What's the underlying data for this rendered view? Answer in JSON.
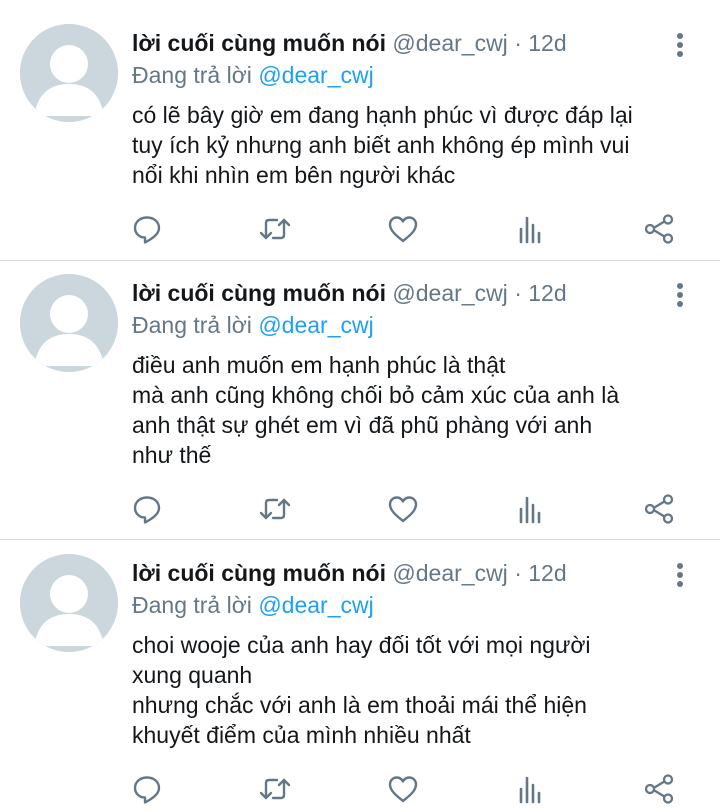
{
  "tweets": [
    {
      "author_name": "lời cuối cùng muốn nói",
      "handle": "@dear_cwj",
      "separator": "·",
      "time": "12d",
      "reply_prefix": "Đang trả lời",
      "reply_handle": "@dear_cwj",
      "lines": [
        "có lẽ bây giờ em đang hạnh phúc vì được đáp lại",
        "tuy ích kỷ nhưng anh biết anh không ép mình vui",
        "nổi khi nhìn em bên người khác"
      ]
    },
    {
      "author_name": "lời cuối cùng muốn nói",
      "handle": "@dear_cwj",
      "separator": "·",
      "time": "12d",
      "reply_prefix": "Đang trả lời",
      "reply_handle": "@dear_cwj",
      "lines": [
        "điều anh muốn em hạnh phúc là thật",
        "mà anh cũng không chối bỏ cảm xúc của anh là",
        "anh thật sự ghét em vì đã phũ phàng với anh",
        "như thế"
      ]
    },
    {
      "author_name": "lời cuối cùng muốn nói",
      "handle": "@dear_cwj",
      "separator": "·",
      "time": "12d",
      "reply_prefix": "Đang trả lời",
      "reply_handle": "@dear_cwj",
      "lines": [
        "choi wooje của anh hay đối tốt với mọi người",
        "xung quanh",
        "nhưng chắc với anh là em thoải mái thể hiện",
        "khuyết điểm của mình nhiều nhất"
      ]
    }
  ],
  "action_icons": [
    "reply-icon",
    "retweet-icon",
    "like-icon",
    "analytics-icon",
    "share-icon"
  ],
  "colors": {
    "text": "#14171a",
    "muted": "#657786",
    "link": "#1da1f2",
    "avatar_bg": "#ccd6dd",
    "divider": "#d4dadf"
  }
}
